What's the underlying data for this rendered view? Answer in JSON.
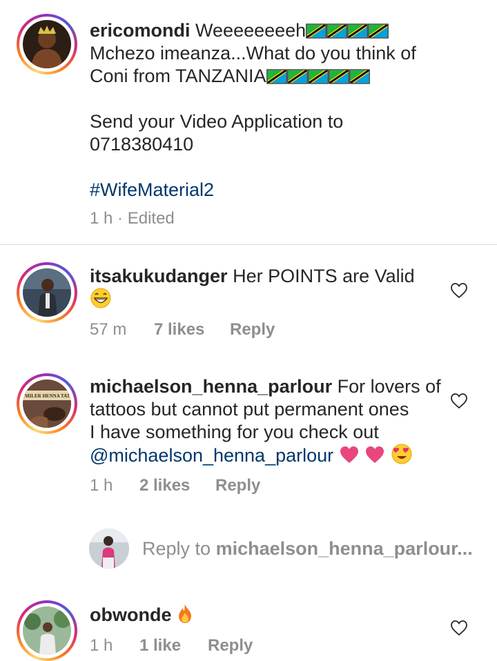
{
  "caption": {
    "username": "ericomondi",
    "line1_text": "Weeeeeeeeh",
    "line2_text": "Mchezo imeanza...What do you think of",
    "line3_text": "Coni from TANZANIA",
    "line4_text": "Send your Video Application to",
    "line5_text": "0718380410",
    "hashtag": "#WifeMaterial2",
    "time": "1 h",
    "separator": "·",
    "edited": "Edited"
  },
  "comments": [
    {
      "username": "itsakukudanger",
      "text": "Her POINTS are Valid",
      "time": "57 m",
      "likes": "7 likes",
      "reply": "Reply"
    },
    {
      "username": "michaelson_henna_parlour",
      "text_line1": "For lovers of",
      "text_line2": "tattoos but cannot put permanent ones",
      "text_line3": "I have something for you check out",
      "mention": "@michaelson_henna_parlour",
      "avatar_text": "MILER HENNA TATT",
      "time": "1 h",
      "likes": "2 likes",
      "reply": "Reply"
    },
    {
      "username": "obwonde",
      "time": "1 h",
      "likes": "1 like",
      "reply": "Reply"
    }
  ],
  "reply_input": {
    "prefix": "Reply to",
    "target": "michaelson_henna_parlour..."
  },
  "colors": {
    "text": "#262626",
    "secondary": "#8e8e8e",
    "link": "#00376b",
    "divider": "#dbdbdb",
    "heart_emoji": "#e8467c",
    "flag_green": "#1eb53a",
    "flag_blue": "#00a3dd"
  },
  "icons": [
    "heart-outline-icon",
    "tanzania-flag-icon",
    "grinning-emoji-icon",
    "pink-heart-emoji-icon",
    "heart-eyes-emoji-icon",
    "fire-emoji-icon"
  ]
}
